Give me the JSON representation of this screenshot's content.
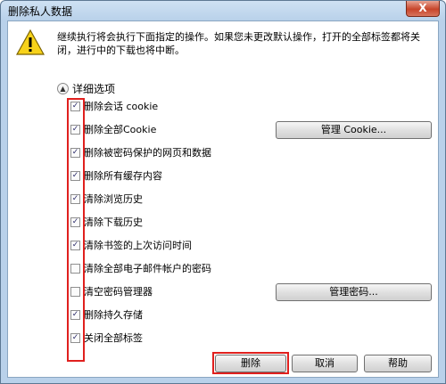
{
  "window": {
    "title": "删除私人数据",
    "close_label": "X"
  },
  "message": "继续执行将会执行下面指定的操作。如果您未更改默认操作，打开的全部标签都将关闭，进行中的下载也将中断。",
  "details": {
    "label": "详细选项"
  },
  "options": [
    {
      "label": "删除会话 cookie",
      "checked": true
    },
    {
      "label": "删除全部Cookie",
      "checked": true
    },
    {
      "label": "删除被密码保护的网页和数据",
      "checked": true
    },
    {
      "label": "删除所有缓存内容",
      "checked": true
    },
    {
      "label": "清除浏览历史",
      "checked": true
    },
    {
      "label": "清除下载历史",
      "checked": true
    },
    {
      "label": "清除书签的上次访问时间",
      "checked": true
    },
    {
      "label": "清除全部电子邮件帐户的密码",
      "checked": false
    },
    {
      "label": "清空密码管理器",
      "checked": false
    },
    {
      "label": "删除持久存储",
      "checked": true
    },
    {
      "label": "关闭全部标签",
      "checked": true
    }
  ],
  "buttons": {
    "manage_cookie": "管理 Cookie...",
    "manage_passwords": "管理密码...",
    "delete": "删除",
    "cancel": "取消",
    "help": "帮助"
  },
  "colors": {
    "highlight": "#e0201e",
    "title_bar": "#b9d1ea"
  }
}
